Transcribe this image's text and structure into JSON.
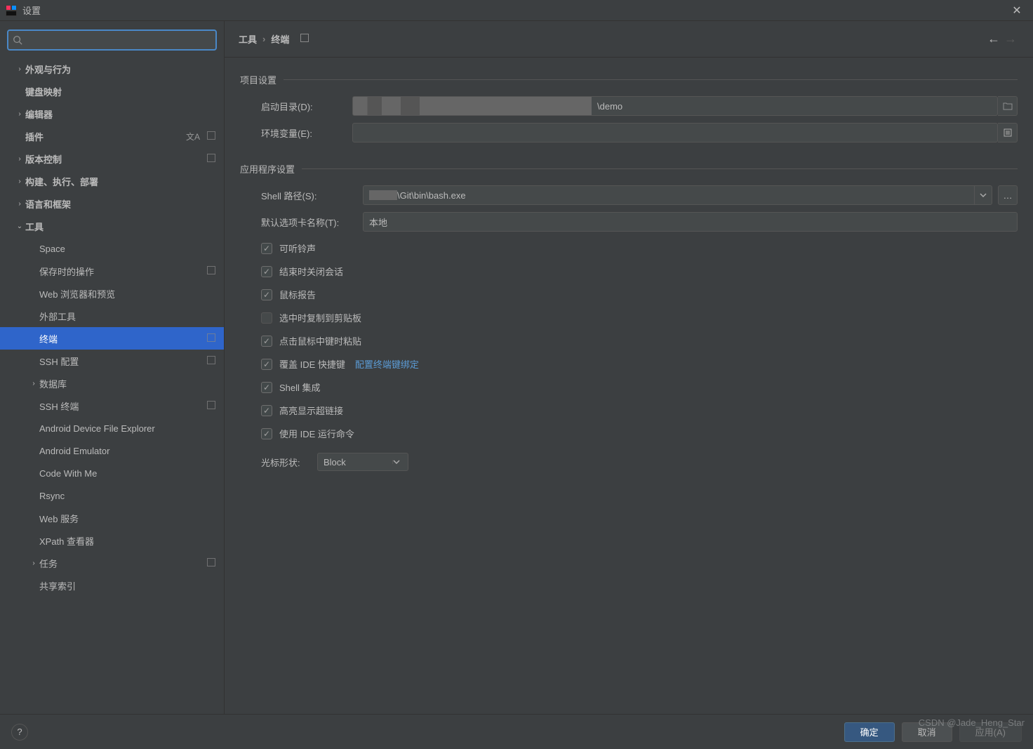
{
  "window": {
    "title": "设置"
  },
  "search": {
    "placeholder": ""
  },
  "sidebar": {
    "items": [
      {
        "label": "外观与行为",
        "expandable": true,
        "expanded": false,
        "bold": true,
        "indent": 0
      },
      {
        "label": "键盘映射",
        "expandable": false,
        "bold": true,
        "indent": 0
      },
      {
        "label": "编辑器",
        "expandable": true,
        "expanded": false,
        "bold": true,
        "indent": 0
      },
      {
        "label": "插件",
        "expandable": false,
        "bold": true,
        "indent": 0,
        "lang": true,
        "badge": true
      },
      {
        "label": "版本控制",
        "expandable": true,
        "expanded": false,
        "bold": true,
        "indent": 0,
        "badge": true
      },
      {
        "label": "构建、执行、部署",
        "expandable": true,
        "expanded": false,
        "bold": true,
        "indent": 0
      },
      {
        "label": "语言和框架",
        "expandable": true,
        "expanded": false,
        "bold": true,
        "indent": 0
      },
      {
        "label": "工具",
        "expandable": true,
        "expanded": true,
        "bold": true,
        "indent": 0
      },
      {
        "label": "Space",
        "indent": 1
      },
      {
        "label": "保存时的操作",
        "indent": 1,
        "badge": true
      },
      {
        "label": "Web 浏览器和预览",
        "indent": 1
      },
      {
        "label": "外部工具",
        "indent": 1
      },
      {
        "label": "终端",
        "indent": 1,
        "selected": true,
        "badge": true
      },
      {
        "label": "SSH 配置",
        "indent": 1,
        "badge": true
      },
      {
        "label": "数据库",
        "indent": 1,
        "expandable": true,
        "expanded": false
      },
      {
        "label": "SSH 终端",
        "indent": 1,
        "badge": true
      },
      {
        "label": "Android Device File Explorer",
        "indent": 1
      },
      {
        "label": "Android Emulator",
        "indent": 1
      },
      {
        "label": "Code With Me",
        "indent": 1
      },
      {
        "label": "Rsync",
        "indent": 1
      },
      {
        "label": "Web 服务",
        "indent": 1
      },
      {
        "label": "XPath 查看器",
        "indent": 1
      },
      {
        "label": "任务",
        "indent": 1,
        "expandable": true,
        "expanded": false,
        "badge": true
      },
      {
        "label": "共享索引",
        "indent": 1
      }
    ]
  },
  "breadcrumb": {
    "root": "工具",
    "leaf": "终端"
  },
  "sections": {
    "project": {
      "title": "项目设置",
      "start_dir_label": "启动目录(D):",
      "start_dir_value": "\\demo",
      "env_label": "环境变量(E):",
      "env_value": ""
    },
    "app": {
      "title": "应用程序设置",
      "shell_label": "Shell 路径(S):",
      "shell_value": "\\Git\\bin\\bash.exe",
      "tab_label": "默认选项卡名称(T):",
      "tab_value": "本地",
      "checks": [
        {
          "label": "可听铃声",
          "checked": true
        },
        {
          "label": "结束时关闭会话",
          "checked": true
        },
        {
          "label": "鼠标报告",
          "checked": true
        },
        {
          "label": "选中时复制到剪贴板",
          "checked": false
        },
        {
          "label": "点击鼠标中键时粘贴",
          "checked": true
        },
        {
          "label": "覆盖 IDE 快捷键",
          "checked": true,
          "link": "配置终端键绑定"
        },
        {
          "label": "Shell 集成",
          "checked": true
        },
        {
          "label": "高亮显示超链接",
          "checked": true
        },
        {
          "label": "使用 IDE 运行命令",
          "checked": true
        }
      ],
      "cursor_label": "光标形状:",
      "cursor_value": "Block"
    }
  },
  "footer": {
    "ok": "确定",
    "cancel": "取消",
    "apply": "应用(A)"
  },
  "watermark": "CSDN @Jade_Heng_Star"
}
